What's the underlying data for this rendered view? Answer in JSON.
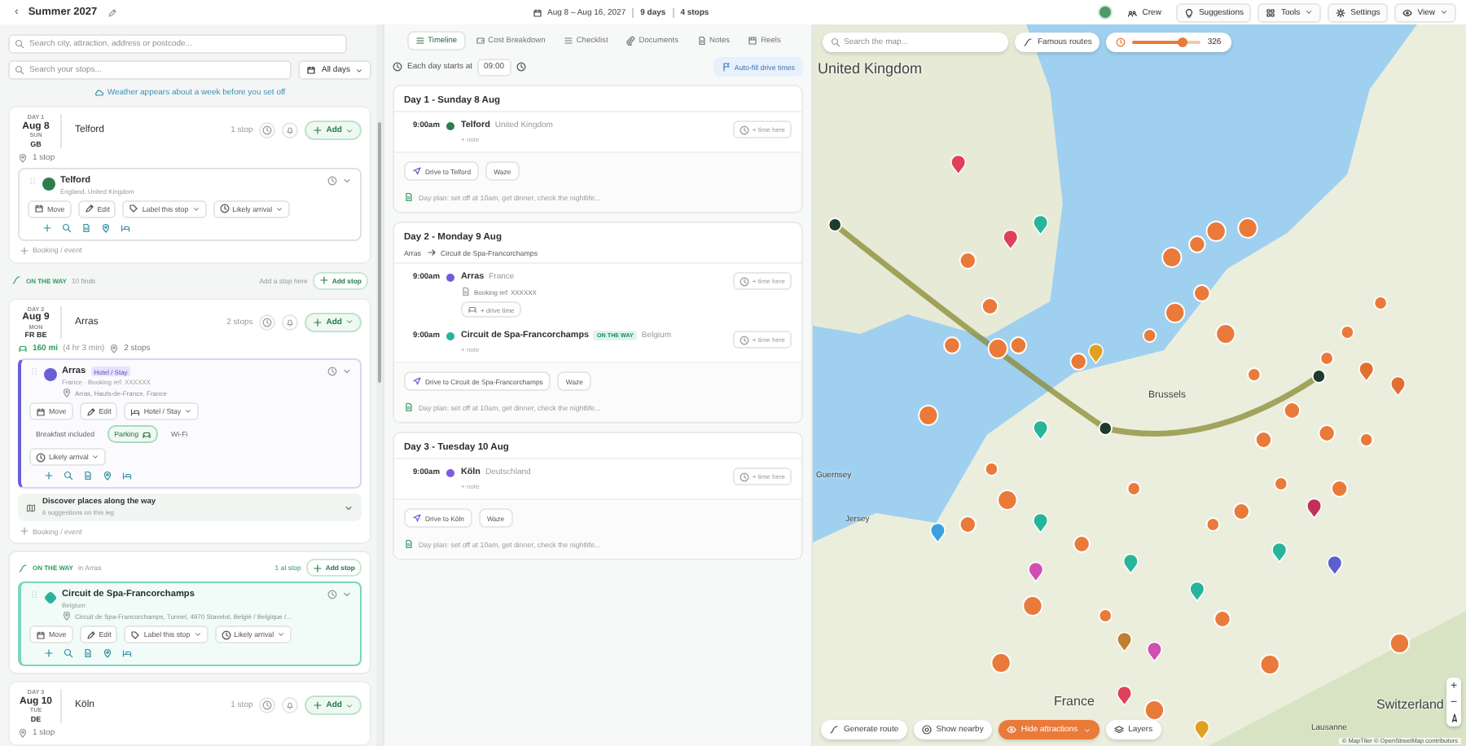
{
  "header": {
    "back": "‹",
    "title": "Summer 2027",
    "dates": "Aug 8 – Aug 16, 2027",
    "days": "9 days",
    "stops": "4 stops",
    "crew": "Crew",
    "buttons": [
      {
        "label": "Suggestions",
        "kind": "bulb",
        "dropdown": false
      },
      {
        "label": "Tools",
        "kind": "grid",
        "dropdown": true
      },
      {
        "label": "Settings",
        "kind": "gear",
        "dropdown": false
      },
      {
        "label": "View",
        "kind": "eye",
        "dropdown": true
      }
    ]
  },
  "sidebar": {
    "search": {
      "placeholder": "Search city, attraction, address or postcode..."
    },
    "stop_search": {
      "placeholder": "Search your stops..."
    },
    "day_filter": "All days",
    "weather_note": "Weather appears about a week before you set off",
    "items": [
      {
        "kind": "day",
        "day": "DAY 1",
        "date": "Aug 8",
        "weekday": "SUN",
        "countries": "GB",
        "place": "Telford",
        "count": "1 stop",
        "add": "Add",
        "summary": [
          {
            "kind": "stops",
            "text": "1 stop"
          }
        ],
        "stops": [
          {
            "name": "Telford",
            "subtitle": "England, United Kingdom",
            "color": "#2e7d4f",
            "actions": [
              {
                "kind": "move",
                "label": "Move"
              },
              {
                "kind": "edit",
                "label": "Edit"
              },
              {
                "kind": "label",
                "label": "Label this stop"
              },
              {
                "kind": "arrival",
                "label": "Likely arrival"
              }
            ]
          }
        ],
        "booking": "Booking / event"
      },
      {
        "kind": "on_the_way",
        "label": "ON THE WAY",
        "note": "10 finds",
        "hint": "Add a stop here",
        "add": "Add stop"
      },
      {
        "kind": "day",
        "day": "DAY 2",
        "date": "Aug 9",
        "weekday": "MON",
        "countries": "FR BE",
        "place": "Arras",
        "count": "2 stops",
        "add": "Add",
        "summary": [
          {
            "kind": "distance",
            "text": "160 mi",
            "detail": "(4 hr 3 min)"
          },
          {
            "kind": "stops",
            "text": "2 stops"
          }
        ],
        "stops": [
          {
            "name": "Arras",
            "badge": "Hotel / Stay",
            "subtitle": "France · Booking ref: XXXXXX",
            "address": "Arras, Hauts-de-France, France",
            "color": "#6b5fd6",
            "actions": [
              {
                "kind": "move",
                "label": "Move"
              },
              {
                "kind": "edit",
                "label": "Edit"
              },
              {
                "kind": "hotel",
                "label": "Hotel / Stay"
              }
            ],
            "amenities": [
              {
                "label": "Breakfast included",
                "on": false
              },
              {
                "label": "Parking",
                "on": true
              },
              {
                "label": "Wi-Fi",
                "on": false
              }
            ],
            "arrival": "Likely arrival"
          }
        ],
        "discover": {
          "title": "Discover places along the way",
          "subtitle": "6 suggestions on this leg"
        },
        "booking": "Booking / event"
      },
      {
        "kind": "on_the_way_card",
        "label": "ON THE WAY",
        "note": "in Arras",
        "hint": "1 at stop",
        "add": "Add stop",
        "stops": [
          {
            "name": "Circuit de Spa-Francorchamps",
            "subtitle": "Belgium",
            "address": "Circuit de Spa-Francorchamps, Tunnel, 4970 Stavelot, België / Belgique /...",
            "color": "#27b59a",
            "actions": [
              {
                "kind": "move",
                "label": "Move"
              },
              {
                "kind": "edit",
                "label": "Edit"
              },
              {
                "kind": "label",
                "label": "Label this stop"
              },
              {
                "kind": "arrival",
                "label": "Likely arrival"
              }
            ]
          }
        ]
      },
      {
        "kind": "day",
        "day": "DAY 3",
        "date": "Aug 10",
        "weekday": "TUE",
        "countries": "DE",
        "place": "Köln",
        "count": "1 stop",
        "add": "Add",
        "summary": [
          {
            "kind": "stops",
            "text": "1 stop"
          }
        ]
      }
    ]
  },
  "planner": {
    "tabs": [
      {
        "label": "Timeline",
        "kind": "timeline",
        "selected": true
      },
      {
        "label": "Cost Breakdown",
        "kind": "cost",
        "selected": false
      },
      {
        "label": "Checklist",
        "kind": "checklist",
        "selected": false
      },
      {
        "label": "Documents",
        "kind": "documents",
        "selected": false
      },
      {
        "label": "Notes",
        "kind": "notes",
        "selected": false
      },
      {
        "label": "Reels",
        "kind": "reels",
        "selected": false
      }
    ],
    "start_label": "Each day starts at",
    "start_time": "09:00",
    "autofill": "Auto-fill drive times",
    "days": [
      {
        "title": "Day 1 - Sunday 8 Aug",
        "stops": [
          {
            "time": "9:00am",
            "name": "Telford",
            "country": "United Kingdom",
            "color": "#2e7d4f",
            "note": "+ note",
            "time_button": "+ time here"
          }
        ],
        "drive": "Drive to Telford",
        "waze": "Waze",
        "plan": "Day plan: set off at 10am, get dinner, check the nightlife..."
      },
      {
        "title": "Day 2 - Monday 9 Aug",
        "route": [
          "Arras",
          "Circuit de Spa-Francorchamps"
        ],
        "stops": [
          {
            "time": "9:00am",
            "name": "Arras",
            "country": "France",
            "color": "#6b5fd6",
            "booking": "Booking ref: XXXXXX",
            "drive_time": "+ drive time",
            "time_button": "+ time here"
          },
          {
            "time": "9:00am",
            "name": "Circuit de Spa-Francorchamps",
            "badge": "ON THE WAY",
            "country": "Belgium",
            "color": "#27b59a",
            "note": "+ note",
            "time_button": "+ time here"
          }
        ],
        "drive": "Drive to Circuit de Spa-Francorchamps",
        "waze": "Waze",
        "plan": "Day plan: set off at 10am, get dinner, check the nightlife..."
      },
      {
        "title": "Day 3 - Tuesday 10 Aug",
        "stops": [
          {
            "time": "9:00am",
            "name": "Köln",
            "country": "Deutschland",
            "color": "#7c5ce0",
            "note": "+ note",
            "time_button": "+ time here"
          }
        ],
        "drive": "Drive to Köln",
        "waze": "Waze",
        "plan": "Day plan: set off at 10am, get dinner, check the nightlife..."
      }
    ]
  },
  "map": {
    "search": {
      "placeholder": "Search the map..."
    },
    "famous_routes": "Famous routes",
    "radius": {
      "level": 0.72,
      "reading": "326"
    },
    "labels": [
      "United Kingdom",
      "Guernsey",
      "Jersey",
      "Brussels",
      "France",
      "Switzerland",
      "Lausanne"
    ],
    "buttons": [
      {
        "label": "Generate route",
        "kind": "route",
        "selected": false
      },
      {
        "label": "Show nearby",
        "kind": "nearby",
        "selected": false
      },
      {
        "label": "Hide attractions",
        "kind": "attractions",
        "selected": true
      },
      {
        "label": "Layers",
        "kind": "layers",
        "selected": false
      }
    ],
    "zoom_in": "+",
    "zoom_out": "−",
    "attribution": "© MapTiler © OpenStreetMap contributors"
  }
}
